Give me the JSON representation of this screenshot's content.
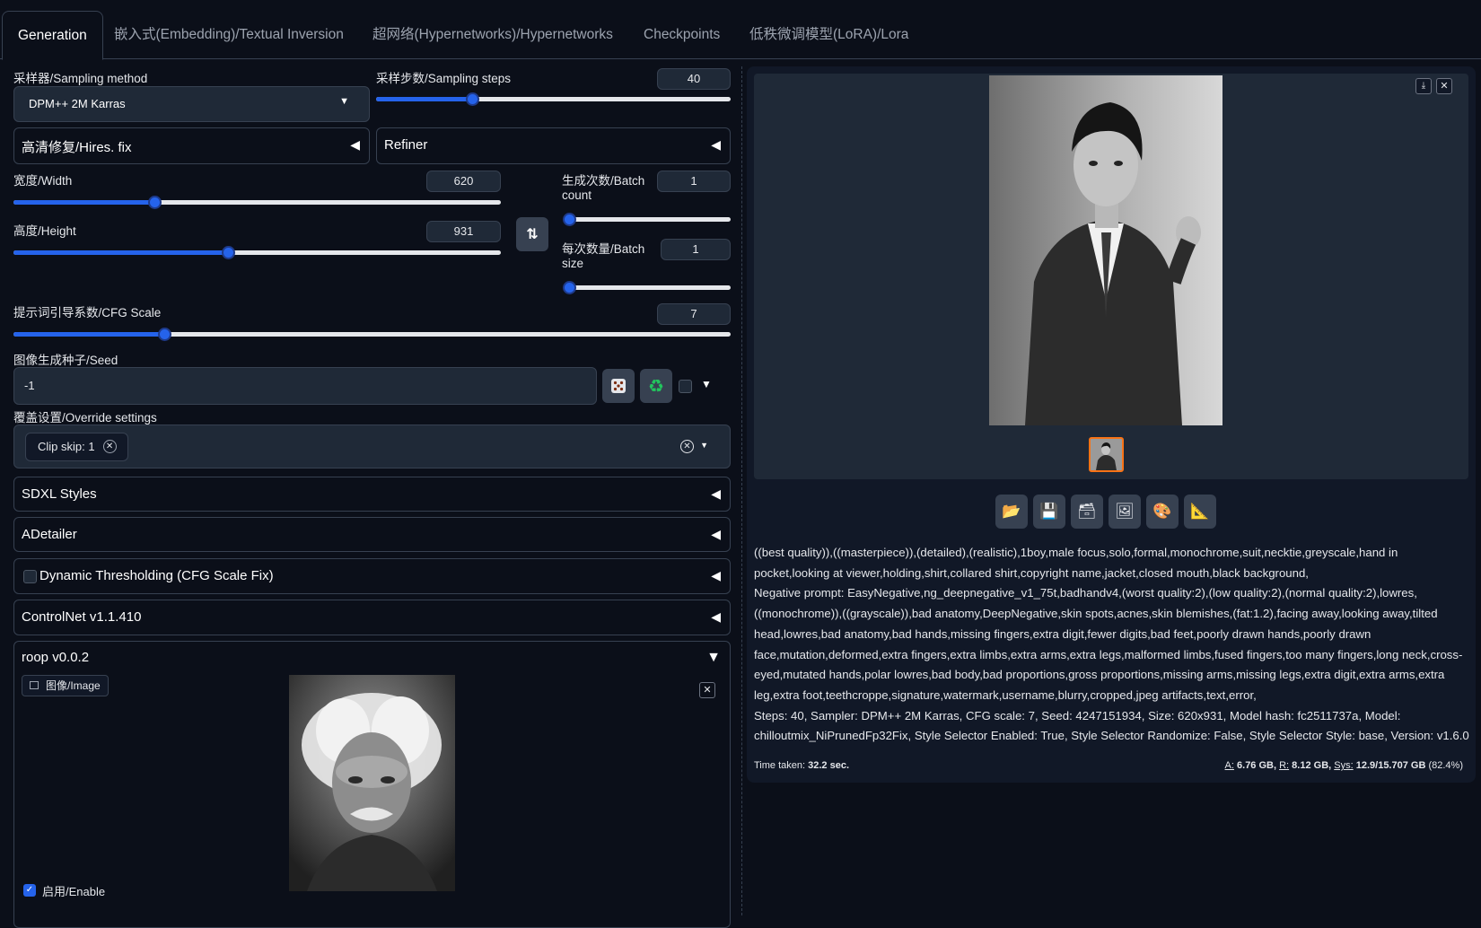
{
  "tabs": [
    {
      "label": "Generation"
    },
    {
      "label": "嵌入式(Embedding)/Textual Inversion"
    },
    {
      "label": "超网络(Hypernetworks)/Hypernetworks"
    },
    {
      "label": "Checkpoints"
    },
    {
      "label": "低秩微调模型(LoRA)/Lora"
    }
  ],
  "sampler": {
    "label": "采样器/Sampling method",
    "value": "DPM++ 2M Karras"
  },
  "steps": {
    "label": "采样步数/Sampling steps",
    "value": "40",
    "fraction": 0.27
  },
  "hires": {
    "label": "高清修复/Hires. fix"
  },
  "refiner": {
    "label": "Refiner"
  },
  "width": {
    "label": "宽度/Width",
    "value": "620",
    "fraction": 0.29
  },
  "height": {
    "label": "高度/Height",
    "value": "931",
    "fraction": 0.44
  },
  "batch_count": {
    "label_line1": "生成次数/Batch",
    "label_line2": "count",
    "value": "1",
    "fraction": 0.0
  },
  "batch_size": {
    "label_line1": "每次数量/Batch",
    "label_line2": "size",
    "value": "1",
    "fraction": 0.0
  },
  "cfg": {
    "label": "提示词引导系数/CFG Scale",
    "value": "7",
    "fraction": 0.21
  },
  "seed": {
    "label": "图像生成种子/Seed",
    "value": "-1"
  },
  "override": {
    "label": "覆盖设置/Override settings",
    "chip": "Clip skip: 1"
  },
  "accordions": {
    "sdxl": "SDXL Styles",
    "adetailer": "ADetailer",
    "dynamic": "Dynamic Thresholding (CFG Scale Fix)",
    "controlnet": "ControlNet v1.1.410",
    "roop": "roop v0.0.2"
  },
  "roop": {
    "image_label": "图像/Image",
    "enable_label": "启用/Enable",
    "enabled": true
  },
  "output": {
    "prompt": "((best quality)),((masterpiece)),(detailed),(realistic),1boy,male focus,solo,formal,monochrome,suit,necktie,greyscale,hand in pocket,looking at viewer,holding,shirt,collared shirt,copyright name,jacket,closed mouth,black background,",
    "negative": "Negative prompt: EasyNegative,ng_deepnegative_v1_75t,badhandv4,(worst quality:2),(low quality:2),(normal quality:2),lowres,((monochrome)),((grayscale)),bad anatomy,DeepNegative,skin spots,acnes,skin blemishes,(fat:1.2),facing away,looking away,tilted head,lowres,bad anatomy,bad hands,missing fingers,extra digit,fewer digits,bad feet,poorly drawn hands,poorly drawn face,mutation,deformed,extra fingers,extra limbs,extra arms,extra legs,malformed limbs,fused fingers,too many fingers,long neck,cross-eyed,mutated hands,polar lowres,bad body,bad proportions,gross proportions,missing arms,missing legs,extra digit,extra arms,extra leg,extra foot,teethcroppe,signature,watermark,username,blurry,cropped,jpeg artifacts,text,error,",
    "params": "Steps: 40, Sampler: DPM++ 2M Karras, CFG scale: 7, Seed: 4247151934, Size: 620x931, Model hash: fc2511737a, Model: chilloutmix_NiPrunedFp32Fix, Style Selector Enabled: True, Style Selector Randomize: False, Style Selector Style: base, Version: v1.6.0",
    "time_label": "Time taken:",
    "time_value": "32.2 sec.",
    "mem_a_label": "A:",
    "mem_a": "6.76 GB,",
    "mem_r_label": "R:",
    "mem_r": "8.12 GB,",
    "mem_sys_label": "Sys:",
    "mem_sys": "12.9/15.707 GB",
    "mem_pct": "(82.4%)"
  },
  "colors": {
    "accent": "#2563eb",
    "bg": "#0b0f19",
    "panel": "#1f2937",
    "border": "#374151",
    "thumb_border": "#f97316"
  }
}
